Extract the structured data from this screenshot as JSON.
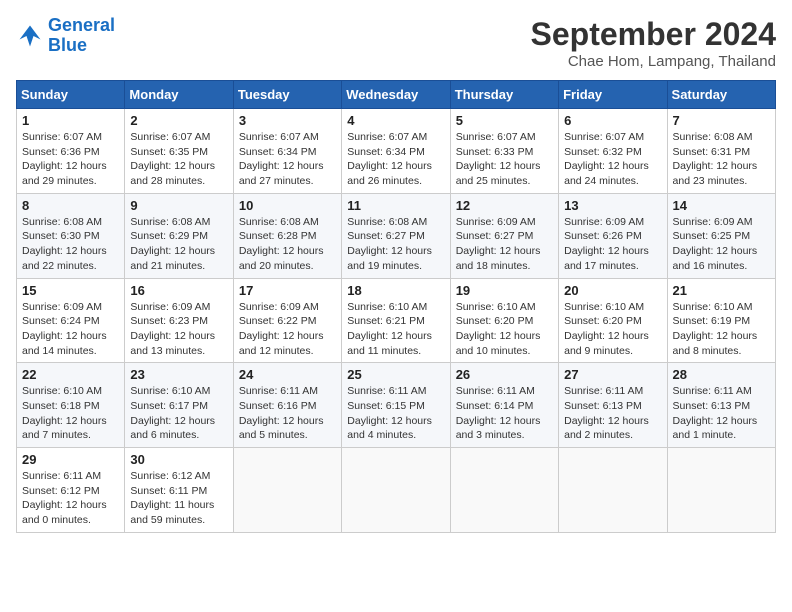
{
  "header": {
    "logo_line1": "General",
    "logo_line2": "Blue",
    "title": "September 2024",
    "subtitle": "Chae Hom, Lampang, Thailand"
  },
  "days_of_week": [
    "Sunday",
    "Monday",
    "Tuesday",
    "Wednesday",
    "Thursday",
    "Friday",
    "Saturday"
  ],
  "weeks": [
    [
      {
        "day": "1",
        "info": "Sunrise: 6:07 AM\nSunset: 6:36 PM\nDaylight: 12 hours\nand 29 minutes."
      },
      {
        "day": "2",
        "info": "Sunrise: 6:07 AM\nSunset: 6:35 PM\nDaylight: 12 hours\nand 28 minutes."
      },
      {
        "day": "3",
        "info": "Sunrise: 6:07 AM\nSunset: 6:34 PM\nDaylight: 12 hours\nand 27 minutes."
      },
      {
        "day": "4",
        "info": "Sunrise: 6:07 AM\nSunset: 6:34 PM\nDaylight: 12 hours\nand 26 minutes."
      },
      {
        "day": "5",
        "info": "Sunrise: 6:07 AM\nSunset: 6:33 PM\nDaylight: 12 hours\nand 25 minutes."
      },
      {
        "day": "6",
        "info": "Sunrise: 6:07 AM\nSunset: 6:32 PM\nDaylight: 12 hours\nand 24 minutes."
      },
      {
        "day": "7",
        "info": "Sunrise: 6:08 AM\nSunset: 6:31 PM\nDaylight: 12 hours\nand 23 minutes."
      }
    ],
    [
      {
        "day": "8",
        "info": "Sunrise: 6:08 AM\nSunset: 6:30 PM\nDaylight: 12 hours\nand 22 minutes."
      },
      {
        "day": "9",
        "info": "Sunrise: 6:08 AM\nSunset: 6:29 PM\nDaylight: 12 hours\nand 21 minutes."
      },
      {
        "day": "10",
        "info": "Sunrise: 6:08 AM\nSunset: 6:28 PM\nDaylight: 12 hours\nand 20 minutes."
      },
      {
        "day": "11",
        "info": "Sunrise: 6:08 AM\nSunset: 6:27 PM\nDaylight: 12 hours\nand 19 minutes."
      },
      {
        "day": "12",
        "info": "Sunrise: 6:09 AM\nSunset: 6:27 PM\nDaylight: 12 hours\nand 18 minutes."
      },
      {
        "day": "13",
        "info": "Sunrise: 6:09 AM\nSunset: 6:26 PM\nDaylight: 12 hours\nand 17 minutes."
      },
      {
        "day": "14",
        "info": "Sunrise: 6:09 AM\nSunset: 6:25 PM\nDaylight: 12 hours\nand 16 minutes."
      }
    ],
    [
      {
        "day": "15",
        "info": "Sunrise: 6:09 AM\nSunset: 6:24 PM\nDaylight: 12 hours\nand 14 minutes."
      },
      {
        "day": "16",
        "info": "Sunrise: 6:09 AM\nSunset: 6:23 PM\nDaylight: 12 hours\nand 13 minutes."
      },
      {
        "day": "17",
        "info": "Sunrise: 6:09 AM\nSunset: 6:22 PM\nDaylight: 12 hours\nand 12 minutes."
      },
      {
        "day": "18",
        "info": "Sunrise: 6:10 AM\nSunset: 6:21 PM\nDaylight: 12 hours\nand 11 minutes."
      },
      {
        "day": "19",
        "info": "Sunrise: 6:10 AM\nSunset: 6:20 PM\nDaylight: 12 hours\nand 10 minutes."
      },
      {
        "day": "20",
        "info": "Sunrise: 6:10 AM\nSunset: 6:20 PM\nDaylight: 12 hours\nand 9 minutes."
      },
      {
        "day": "21",
        "info": "Sunrise: 6:10 AM\nSunset: 6:19 PM\nDaylight: 12 hours\nand 8 minutes."
      }
    ],
    [
      {
        "day": "22",
        "info": "Sunrise: 6:10 AM\nSunset: 6:18 PM\nDaylight: 12 hours\nand 7 minutes."
      },
      {
        "day": "23",
        "info": "Sunrise: 6:10 AM\nSunset: 6:17 PM\nDaylight: 12 hours\nand 6 minutes."
      },
      {
        "day": "24",
        "info": "Sunrise: 6:11 AM\nSunset: 6:16 PM\nDaylight: 12 hours\nand 5 minutes."
      },
      {
        "day": "25",
        "info": "Sunrise: 6:11 AM\nSunset: 6:15 PM\nDaylight: 12 hours\nand 4 minutes."
      },
      {
        "day": "26",
        "info": "Sunrise: 6:11 AM\nSunset: 6:14 PM\nDaylight: 12 hours\nand 3 minutes."
      },
      {
        "day": "27",
        "info": "Sunrise: 6:11 AM\nSunset: 6:13 PM\nDaylight: 12 hours\nand 2 minutes."
      },
      {
        "day": "28",
        "info": "Sunrise: 6:11 AM\nSunset: 6:13 PM\nDaylight: 12 hours\nand 1 minute."
      }
    ],
    [
      {
        "day": "29",
        "info": "Sunrise: 6:11 AM\nSunset: 6:12 PM\nDaylight: 12 hours\nand 0 minutes."
      },
      {
        "day": "30",
        "info": "Sunrise: 6:12 AM\nSunset: 6:11 PM\nDaylight: 11 hours\nand 59 minutes."
      },
      {
        "day": "",
        "info": ""
      },
      {
        "day": "",
        "info": ""
      },
      {
        "day": "",
        "info": ""
      },
      {
        "day": "",
        "info": ""
      },
      {
        "day": "",
        "info": ""
      }
    ]
  ]
}
